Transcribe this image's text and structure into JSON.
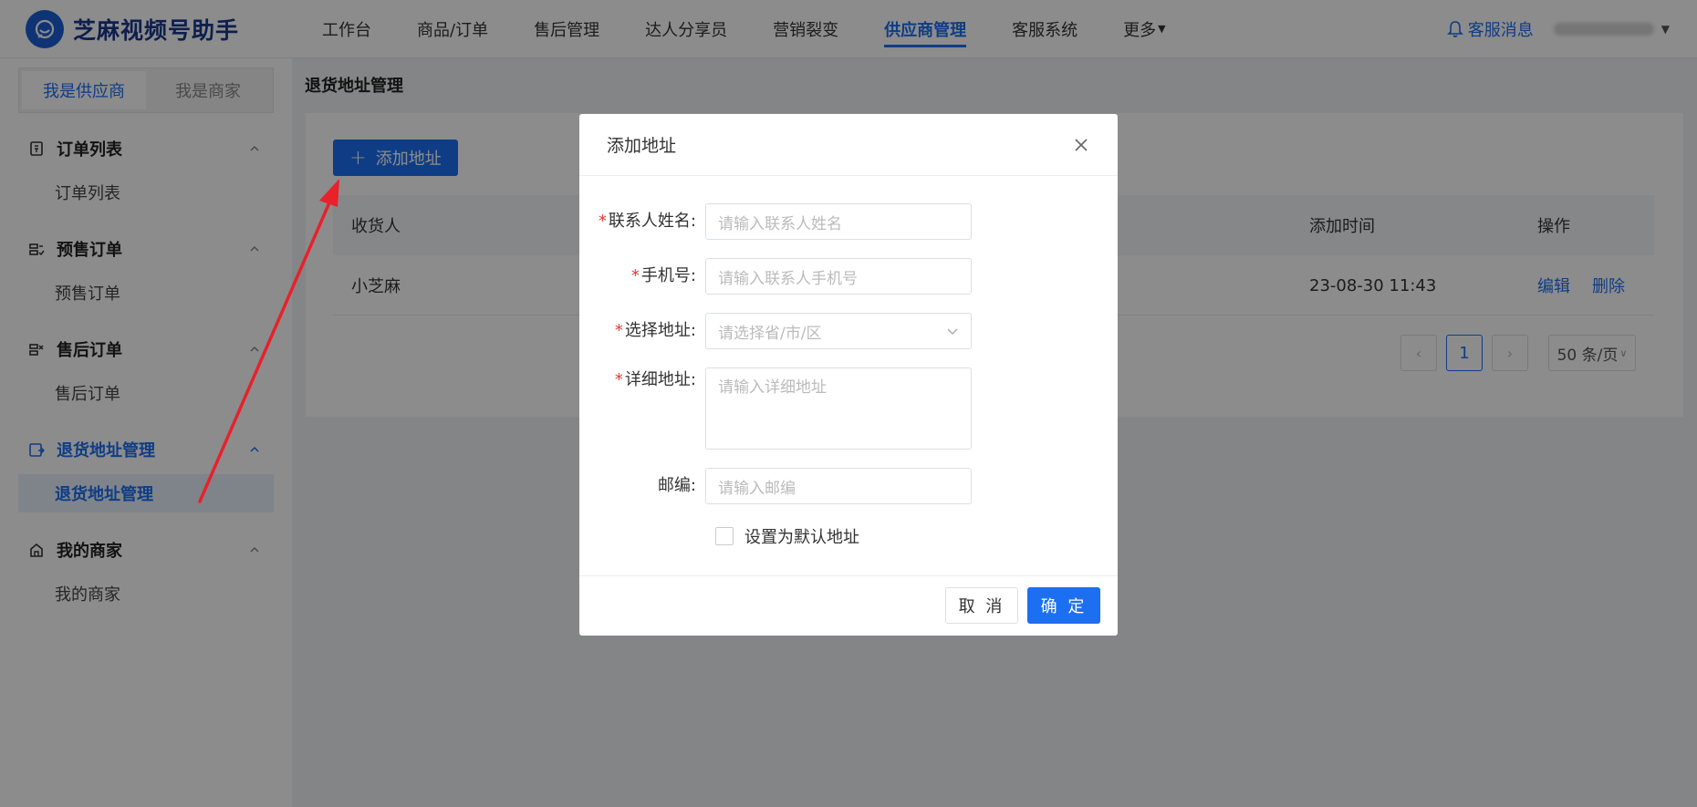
{
  "app": {
    "name": "芝麻视频号助手"
  },
  "nav": {
    "items": [
      {
        "label": "工作台",
        "active": false
      },
      {
        "label": "商品/订单",
        "active": false
      },
      {
        "label": "售后管理",
        "active": false
      },
      {
        "label": "达人分享员",
        "active": false
      },
      {
        "label": "营销裂变",
        "active": false
      },
      {
        "label": "供应商管理",
        "active": true
      },
      {
        "label": "客服系统",
        "active": false
      },
      {
        "label": "更多",
        "active": false,
        "has_caret": true
      }
    ],
    "notify_label": "客服消息"
  },
  "sidebar": {
    "role_tabs": [
      {
        "label": "我是供应商",
        "active": true
      },
      {
        "label": "我是商家",
        "active": false
      }
    ],
    "groups": [
      {
        "title": "订单列表",
        "icon": "order-list-icon",
        "sub": "订单列表",
        "active": false
      },
      {
        "title": "预售订单",
        "icon": "presale-icon",
        "sub": "预售订单",
        "active": false
      },
      {
        "title": "售后订单",
        "icon": "aftersale-icon",
        "sub": "售后订单",
        "active": false
      },
      {
        "title": "退货地址管理",
        "icon": "return-address-icon",
        "sub": "退货地址管理",
        "active": true
      },
      {
        "title": "我的商家",
        "icon": "merchant-icon",
        "sub": "我的商家",
        "active": false
      }
    ]
  },
  "main": {
    "page_title": "退货地址管理",
    "add_button": "添加地址",
    "table": {
      "columns": [
        "收货人",
        "添加时间",
        "操作"
      ],
      "rows": [
        {
          "receiver": "小芝麻",
          "time": "23-08-30 11:43",
          "actions": [
            "编辑",
            "删除"
          ]
        }
      ]
    },
    "pagination": {
      "current": "1",
      "page_size": "50 条/页"
    }
  },
  "modal": {
    "title": "添加地址",
    "fields": [
      {
        "label": "联系人姓名:",
        "required": true,
        "placeholder": "请输入联系人姓名",
        "type": "text"
      },
      {
        "label": "手机号:",
        "required": true,
        "placeholder": "请输入联系人手机号",
        "type": "text"
      },
      {
        "label": "选择地址:",
        "required": true,
        "placeholder": "请选择省/市/区",
        "type": "select"
      },
      {
        "label": "详细地址:",
        "required": true,
        "placeholder": "请输入详细地址",
        "type": "textarea"
      },
      {
        "label": "邮编:",
        "required": false,
        "placeholder": "请输入邮编",
        "type": "text"
      }
    ],
    "default_checkbox_label": "设置为默认地址",
    "default_checked": false,
    "cancel_label": "取 消",
    "ok_label": "确 定"
  },
  "colors": {
    "primary": "#1d6ff2",
    "annotation_arrow": "#e8212b",
    "required": "#e53935"
  }
}
